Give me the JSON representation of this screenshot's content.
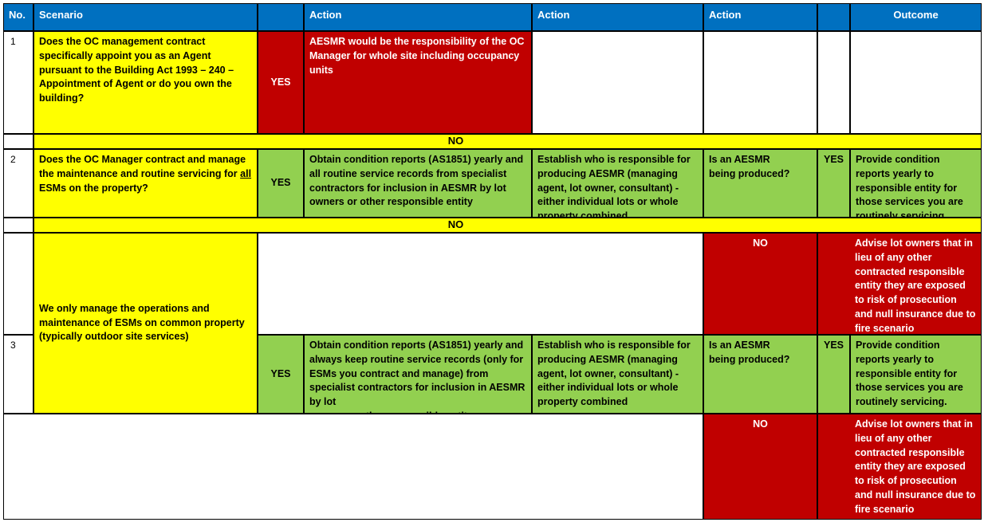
{
  "colors": {
    "header_blue": "#0070C0",
    "yellow": "#FFFF00",
    "red": "#C00000",
    "green": "#92D050",
    "white": "#FFFFFF",
    "border": "#000000"
  },
  "table": {
    "headers": {
      "no": "No.",
      "scenario": "Scenario",
      "answer_blank": "",
      "action1": "Action",
      "action2": "Action",
      "action3": "Action",
      "answer2_blank": "",
      "outcome": "Outcome"
    },
    "rows": {
      "r1": {
        "no": "1",
        "scenario": "Does the OC management contract specifically appoint you as an Agent pursuant to the Building Act 1993 – 240 – Appointment of Agent or do you own the building?",
        "answer": "YES",
        "action1": "AESMR would be the responsibility of the OC Manager for whole site including occupancy units",
        "action2": "",
        "action3": "",
        "answer2": "",
        "outcome": ""
      },
      "divider1": {
        "label": "NO"
      },
      "r2": {
        "no": "2",
        "scenario_part1": "Does the OC Manager contract and manage the maintenance and routine servicing for ",
        "scenario_underline": "all",
        "scenario_part2": " ESMs on the property?",
        "answer": "YES",
        "action1": "Obtain condition reports (AS1851) yearly and all routine service records from specialist contractors for inclusion in AESMR by lot owners or other responsible entity",
        "action2": "Establish who is responsible for producing AESMR (managing agent, lot owner, consultant) - either individual lots or whole property combined",
        "action3": "Is an AESMR\nbeing produced?",
        "answer2": "YES",
        "outcome": "Provide condition reports yearly to responsible entity for those services you are routinely servicing."
      },
      "divider2": {
        "label": "NO"
      },
      "r2no": {
        "action3_answer": "NO",
        "outcome": "Advise lot owners that in lieu of any other contracted responsible entity they are exposed to risk of prosecution and null insurance due to fire scenario"
      },
      "r3": {
        "no": "3",
        "scenario": "We only manage the operations and maintenance of ESMs on common property (typically outdoor site services)",
        "answer": "YES",
        "action1": "Obtain condition reports (AS1851) yearly and always keep routine service records (only for ESMs you contract and manage) from specialist contractors for inclusion in AESMR by lot\nowners or other responsible entity",
        "action2": "Establish who is responsible for producing AESMR (managing agent, lot owner, consultant) - either individual lots or whole property combined",
        "action3": "Is an AESMR\nbeing produced?",
        "answer2": "YES",
        "outcome": "Provide condition reports yearly to responsible entity for those services you are routinely servicing."
      },
      "r3no": {
        "action3_answer": "NO",
        "outcome": "Advise lot owners that in lieu of any other contracted responsible entity they are exposed to risk of prosecution and null insurance due to fire scenario"
      }
    }
  }
}
